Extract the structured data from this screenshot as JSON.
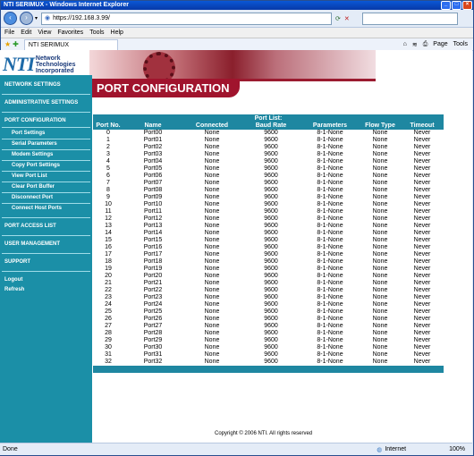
{
  "browser": {
    "title": "NTI SERIMUX - Windows Internet Explorer",
    "address": "https://192.168.3.99/",
    "menu": [
      "File",
      "Edit",
      "View",
      "Favorites",
      "Tools",
      "Help"
    ],
    "tab_title": "NTI SERIMUX",
    "tools": [
      "Page",
      "Tools"
    ],
    "status_left": "Done",
    "status_zone": "Internet",
    "zoom": "100%"
  },
  "logo": {
    "mark": "NTI",
    "line1": "Network",
    "line2": "Technologies",
    "line3": "Incorporated"
  },
  "page_header": "PORT CONFIGURATION",
  "sidebar": {
    "network": "NETWORK SETTINGS",
    "admin": "ADMINISTRATIVE SETTINGS",
    "port_config": "PORT CONFIGURATION",
    "sub_items": [
      "Port Settings",
      "Serial Parameters",
      "Modem Settings",
      "Copy Port Settings",
      "View Port List",
      "Clear Port Buffer",
      "Disconnect Port",
      "Connect Host Ports"
    ],
    "access": "PORT ACCESS LIST",
    "users": "USER MANAGEMENT",
    "support": "SUPPORT",
    "logout": "Logout",
    "refresh": "Refresh"
  },
  "port_list": {
    "caption": "Port List:",
    "columns": [
      "Port No.",
      "Name",
      "Connected",
      "Baud Rate",
      "Parameters",
      "Flow Type",
      "Timeout"
    ],
    "rows": [
      [
        "0",
        "Port00",
        "None",
        "9600",
        "8-1-None",
        "None",
        "Never"
      ],
      [
        "1",
        "Port01",
        "None",
        "9600",
        "8-1-None",
        "None",
        "Never"
      ],
      [
        "2",
        "Port02",
        "None",
        "9600",
        "8-1-None",
        "None",
        "Never"
      ],
      [
        "3",
        "Port03",
        "None",
        "9600",
        "8-1-None",
        "None",
        "Never"
      ],
      [
        "4",
        "Port04",
        "None",
        "9600",
        "8-1-None",
        "None",
        "Never"
      ],
      [
        "5",
        "Port05",
        "None",
        "9600",
        "8-1-None",
        "None",
        "Never"
      ],
      [
        "6",
        "Port06",
        "None",
        "9600",
        "8-1-None",
        "None",
        "Never"
      ],
      [
        "7",
        "Port07",
        "None",
        "9600",
        "8-1-None",
        "None",
        "Never"
      ],
      [
        "8",
        "Port08",
        "None",
        "9600",
        "8-1-None",
        "None",
        "Never"
      ],
      [
        "9",
        "Port09",
        "None",
        "9600",
        "8-1-None",
        "None",
        "Never"
      ],
      [
        "10",
        "Port10",
        "None",
        "9600",
        "8-1-None",
        "None",
        "Never"
      ],
      [
        "11",
        "Port11",
        "None",
        "9600",
        "8-1-None",
        "None",
        "Never"
      ],
      [
        "12",
        "Port12",
        "None",
        "9600",
        "8-1-None",
        "None",
        "Never"
      ],
      [
        "13",
        "Port13",
        "None",
        "9600",
        "8-1-None",
        "None",
        "Never"
      ],
      [
        "14",
        "Port14",
        "None",
        "9600",
        "8-1-None",
        "None",
        "Never"
      ],
      [
        "15",
        "Port15",
        "None",
        "9600",
        "8-1-None",
        "None",
        "Never"
      ],
      [
        "16",
        "Port16",
        "None",
        "9600",
        "8-1-None",
        "None",
        "Never"
      ],
      [
        "17",
        "Port17",
        "None",
        "9600",
        "8-1-None",
        "None",
        "Never"
      ],
      [
        "18",
        "Port18",
        "None",
        "9600",
        "8-1-None",
        "None",
        "Never"
      ],
      [
        "19",
        "Port19",
        "None",
        "9600",
        "8-1-None",
        "None",
        "Never"
      ],
      [
        "20",
        "Port20",
        "None",
        "9600",
        "8-1-None",
        "None",
        "Never"
      ],
      [
        "21",
        "Port21",
        "None",
        "9600",
        "8-1-None",
        "None",
        "Never"
      ],
      [
        "22",
        "Port22",
        "None",
        "9600",
        "8-1-None",
        "None",
        "Never"
      ],
      [
        "23",
        "Port23",
        "None",
        "9600",
        "8-1-None",
        "None",
        "Never"
      ],
      [
        "24",
        "Port24",
        "None",
        "9600",
        "8-1-None",
        "None",
        "Never"
      ],
      [
        "25",
        "Port25",
        "None",
        "9600",
        "8-1-None",
        "None",
        "Never"
      ],
      [
        "26",
        "Port26",
        "None",
        "9600",
        "8-1-None",
        "None",
        "Never"
      ],
      [
        "27",
        "Port27",
        "None",
        "9600",
        "8-1-None",
        "None",
        "Never"
      ],
      [
        "28",
        "Port28",
        "None",
        "9600",
        "8-1-None",
        "None",
        "Never"
      ],
      [
        "29",
        "Port29",
        "None",
        "9600",
        "8-1-None",
        "None",
        "Never"
      ],
      [
        "30",
        "Port30",
        "None",
        "9600",
        "8-1-None",
        "None",
        "Never"
      ],
      [
        "31",
        "Port31",
        "None",
        "9600",
        "8-1-None",
        "None",
        "Never"
      ],
      [
        "32",
        "Port32",
        "None",
        "9600",
        "8-1-None",
        "None",
        "Never"
      ]
    ]
  },
  "copyright": "Copyright © 2006 NTI. All rights reserved"
}
